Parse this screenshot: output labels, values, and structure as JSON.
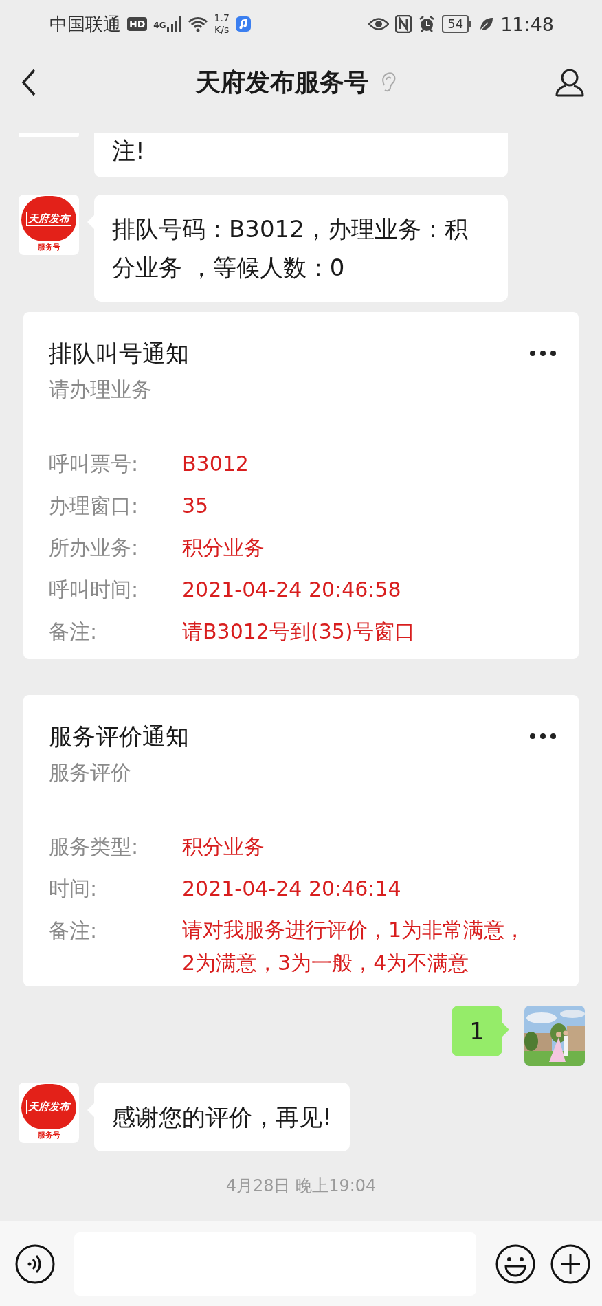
{
  "status_bar": {
    "carrier": "中国联通",
    "hd_badge": "HD",
    "network": "4G",
    "speed_value": "1.7",
    "speed_unit": "K/s",
    "battery": "54",
    "time": "11:48"
  },
  "header": {
    "title": "天府发布服务号"
  },
  "messages": [
    {
      "kind": "text_cut",
      "text": "注!"
    },
    {
      "kind": "text",
      "outgoing": false,
      "avatar": {
        "logo": "天府发布",
        "label": "服务号"
      },
      "text": "排队号码：B3012，办理业务：积分业务 ，等候人数：0"
    },
    {
      "kind": "card",
      "title": "排队叫号通知",
      "subtitle": "请办理业务",
      "rows": [
        {
          "label": "呼叫票号:",
          "value": "B3012"
        },
        {
          "label": "办理窗口:",
          "value": "35"
        },
        {
          "label": "所办业务:",
          "value": "积分业务"
        },
        {
          "label": "呼叫时间:",
          "value": "2021-04-24 20:46:58"
        },
        {
          "label": "备注:",
          "value": "请B3012号到(35)号窗口"
        }
      ]
    },
    {
      "kind": "card",
      "title": "服务评价通知",
      "subtitle": "服务评价",
      "rows": [
        {
          "label": "服务类型:",
          "value": "积分业务"
        },
        {
          "label": "时间:",
          "value": "2021-04-24 20:46:14"
        },
        {
          "label": "备注:",
          "value": "请对我服务进行评价，1为非常满意，2为满意，3为一般，4为不满意"
        }
      ]
    },
    {
      "kind": "text",
      "outgoing": true,
      "text": "1"
    },
    {
      "kind": "text",
      "outgoing": false,
      "avatar": {
        "logo": "天府发布",
        "label": "服务号"
      },
      "text": "感谢您的评价，再见!"
    },
    {
      "kind": "time",
      "text": "4月28日 晚上19:04"
    }
  ]
}
